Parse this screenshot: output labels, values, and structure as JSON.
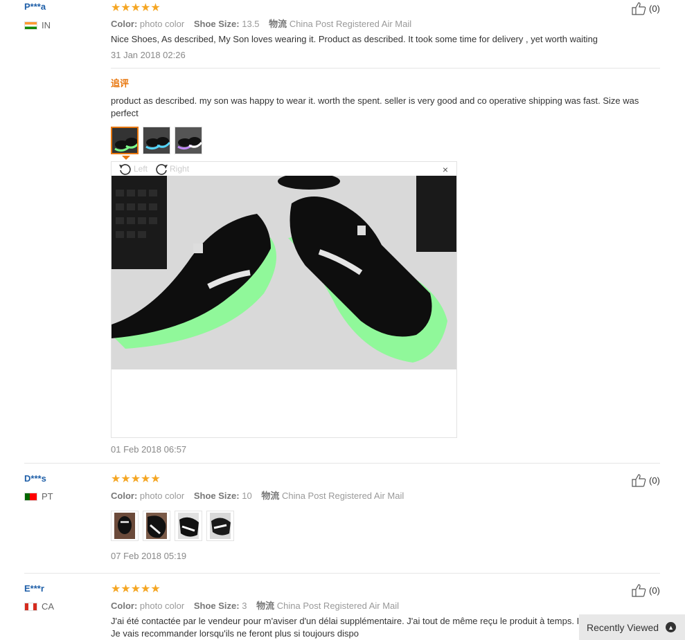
{
  "reviews": [
    {
      "user": "P***a",
      "country": "IN",
      "stars": "★★★★★",
      "color_label": "Color:",
      "color_value": "photo color",
      "size_label": "Shoe Size:",
      "size_value": "13.5",
      "shipping_label": "物流",
      "shipping_value": "China Post Registered Air Mail",
      "text": "Nice Shoes, As described, My Son loves wearing it. Product as described. It took some time for delivery , yet worth waiting",
      "date": "31 Jan 2018 02:26",
      "helpful": "(0)",
      "additional": {
        "label": "追评",
        "text": "product as described. my son was happy to wear it. worth the spent. seller is very good and co operative shipping was fast. Size was perfect",
        "rotate_left": "Left",
        "rotate_right": "Right",
        "close": "×",
        "date": "01 Feb 2018 06:57"
      }
    },
    {
      "user": "D***s",
      "country": "PT",
      "stars": "★★★★★",
      "color_label": "Color:",
      "color_value": "photo color",
      "size_label": "Shoe Size:",
      "size_value": "10",
      "shipping_label": "物流",
      "shipping_value": "China Post Registered Air Mail",
      "date": "07 Feb 2018 05:19",
      "helpful": "(0)"
    },
    {
      "user": "E***r",
      "country": "CA",
      "stars": "★★★★★",
      "color_label": "Color:",
      "color_value": "photo color",
      "size_label": "Shoe Size:",
      "size_value": "3",
      "shipping_label": "物流",
      "shipping_value": "China Post Registered Air Mail",
      "text": "J'ai été contactée par le vendeur pour m'aviser d'un délai supplémentaire. J'ai tout de même reçu le produit à temps. Il fonctionne bien. Je vais recommander lorsqu'ils ne feront plus si toujours dispo",
      "helpful": "(0)"
    }
  ],
  "recently_viewed": "Recently Viewed",
  "colors": {
    "accent": "#e8770e",
    "star": "#f5a623",
    "link": "#1f5fa8"
  },
  "icons": [
    "thumbs-up-icon",
    "rotate-left-icon",
    "rotate-right-icon",
    "close-icon",
    "chevron-up-icon"
  ]
}
